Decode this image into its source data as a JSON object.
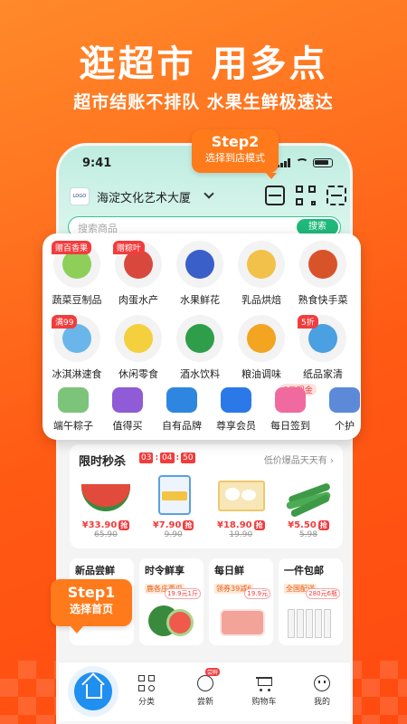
{
  "promo": {
    "title": "逛超市 用多点",
    "subtitle": "超市结账不排队 水果生鲜极速达"
  },
  "status_bar": {
    "time": "9:41"
  },
  "header": {
    "location": "海淀文化艺术大厦",
    "search_placeholder": "搜索商品",
    "search_button": "搜索"
  },
  "callouts": {
    "step2_title": "Step2",
    "step2_desc": "选择到店模式",
    "step1_title": "Step1",
    "step1_desc": "选择首页"
  },
  "categories": [
    {
      "label": "蔬菜豆制品",
      "badge": "赠百香果",
      "color": "#8ecf5a"
    },
    {
      "label": "肉蛋水产",
      "badge": "赠粽叶",
      "color": "#d9483d"
    },
    {
      "label": "水果鲜花",
      "badge": "",
      "color": "#3b5fc9"
    },
    {
      "label": "乳品烘焙",
      "badge": "",
      "color": "#f2c14a"
    },
    {
      "label": "熟食快手菜",
      "badge": "",
      "color": "#d8532a"
    },
    {
      "label": "冰淇淋速食",
      "badge": "满99",
      "color": "#6ab6ea"
    },
    {
      "label": "休闲零食",
      "badge": "",
      "color": "#f4d03f"
    },
    {
      "label": "酒水饮料",
      "badge": "",
      "color": "#2e9e4a"
    },
    {
      "label": "粮油调味",
      "badge": "",
      "color": "#f3a420"
    },
    {
      "label": "纸品家清",
      "badge": "5折",
      "color": "#4aa0e0"
    }
  ],
  "quick_links": [
    {
      "label": "端午粽子",
      "badge": "",
      "color": "#7cc47a"
    },
    {
      "label": "值得买",
      "badge": "",
      "color": "#8f5bd6"
    },
    {
      "label": "自有品牌",
      "badge": "",
      "color": "#2f86e0"
    },
    {
      "label": "尊享会员",
      "badge": "",
      "color": "#2b79e8"
    },
    {
      "label": "每日签到",
      "badge": "5元现金",
      "color": "#f06aa0"
    },
    {
      "label": "个护",
      "badge": "",
      "color": "#5c8ad9"
    }
  ],
  "flash_sale": {
    "title": "限时秒杀",
    "timer": [
      "03",
      "04",
      "50"
    ],
    "more": "低价爆品天天有 ›",
    "items": [
      {
        "price": "¥33.90",
        "old": "65.90",
        "tag": "抢",
        "color": "#e24a3b"
      },
      {
        "price": "¥7.90",
        "old": "9.90",
        "tag": "抢",
        "color": "#5aa0e0"
      },
      {
        "price": "¥18.90",
        "old": "19.90",
        "tag": "抢",
        "color": "#f6d47a"
      },
      {
        "price": "¥5.50",
        "old": "5.98",
        "tag": "抢",
        "color": "#3e9a47"
      }
    ]
  },
  "promo_cards": [
    {
      "title": "新品尝鲜",
      "tag": "",
      "mini": ""
    },
    {
      "title": "时令鲜享",
      "tag": "鹿各庄西瓜",
      "mini": "19.9元1斤"
    },
    {
      "title": "每日鲜",
      "tag": "领券39减6",
      "mini": "19.9元"
    },
    {
      "title": "一件包邮",
      "tag": "全国配送",
      "mini": "280元6瓶"
    }
  ],
  "tabbar": [
    {
      "label": "分类"
    },
    {
      "label": "尝新",
      "badge": "尝鲜"
    },
    {
      "label": "购物车"
    },
    {
      "label": "我的"
    }
  ]
}
